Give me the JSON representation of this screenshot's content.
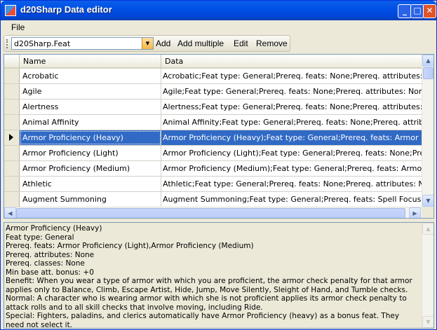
{
  "window": {
    "title": "d20Sharp Data editor"
  },
  "menu": {
    "file_label": "File"
  },
  "toolbar": {
    "combo_value": "d20Sharp.Feat",
    "add_label": "Add",
    "add_multiple_label": "Add multiple",
    "edit_label": "Edit",
    "remove_label": "Remove"
  },
  "grid": {
    "columns": [
      "Name",
      "Data"
    ],
    "rows": [
      {
        "name": "Acrobatic",
        "data": "Acrobatic;Feat type: General;Prereq. feats: None;Prereq. attributes: None;Prer..."
      },
      {
        "name": "Agile",
        "data": "Agile;Feat type: General;Prereq. feats: None;Prereq. attributes: None;Prereq. cl"
      },
      {
        "name": "Alertness",
        "data": "Alertness;Feat type: General;Prereq. feats: None;Prereq. attributes: None;Prere"
      },
      {
        "name": "Animal Affinity",
        "data": "Animal Affinity;Feat type: General;Prereq. feats: None;Prereq. attributes: None;."
      },
      {
        "name": "Armor Proficiency (Heavy)",
        "data": "Armor Proficiency (Heavy);Feat type: General;Prereq. feats: Armor Proficiency (..."
      },
      {
        "name": "Armor Proficiency (Light)",
        "data": "Armor Proficiency (Light);Feat type: General;Prereq. feats: None;Prereq. attribut"
      },
      {
        "name": "Armor Proficiency (Medium)",
        "data": "Armor Proficiency (Medium);Feat type: General;Prereq. feats: Armor Proficiency"
      },
      {
        "name": "Athletic",
        "data": "Athletic;Feat type: General;Prereq. feats: None;Prereq. attributes: None;Prere..."
      },
      {
        "name": "Augment Summoning",
        "data": "Augment Summoning;Feat type: General;Prereq. feats: Spell Focus;Prereq. attri"
      }
    ],
    "selected_index": 4
  },
  "details": {
    "text": "Armor Proficiency (Heavy)\nFeat type: General\nPrereq. feats: Armor Proficiency (Light),Armor Proficiency (Medium)\nPrereq. attributes: None\nPrereq. classes: None\nMin base att. bonus: +0\nBenefit: When you wear a type of armor with which you are proficient, the armor check penalty for that armor applies only to Balance, Climb, Escape Artist, Hide, Jump, Move Silently, Sleight of Hand, and Tumble checks.\nNormal: A character who is wearing armor with which she is not proficient applies its armor check penalty to attack rolls and to all skill checks that involve moving, including Ride.\nSpecial: Fighters, paladins, and clerics automatically have Armor Proficiency (heavy) as a bonus feat. They need not select it."
  },
  "icons": {
    "app": "app-icon",
    "minimize": "minimize-icon",
    "maximize": "maximize-icon",
    "close": "close-icon",
    "dropdown": "chevron-down-icon",
    "row_pointer": "row-pointer-icon"
  }
}
